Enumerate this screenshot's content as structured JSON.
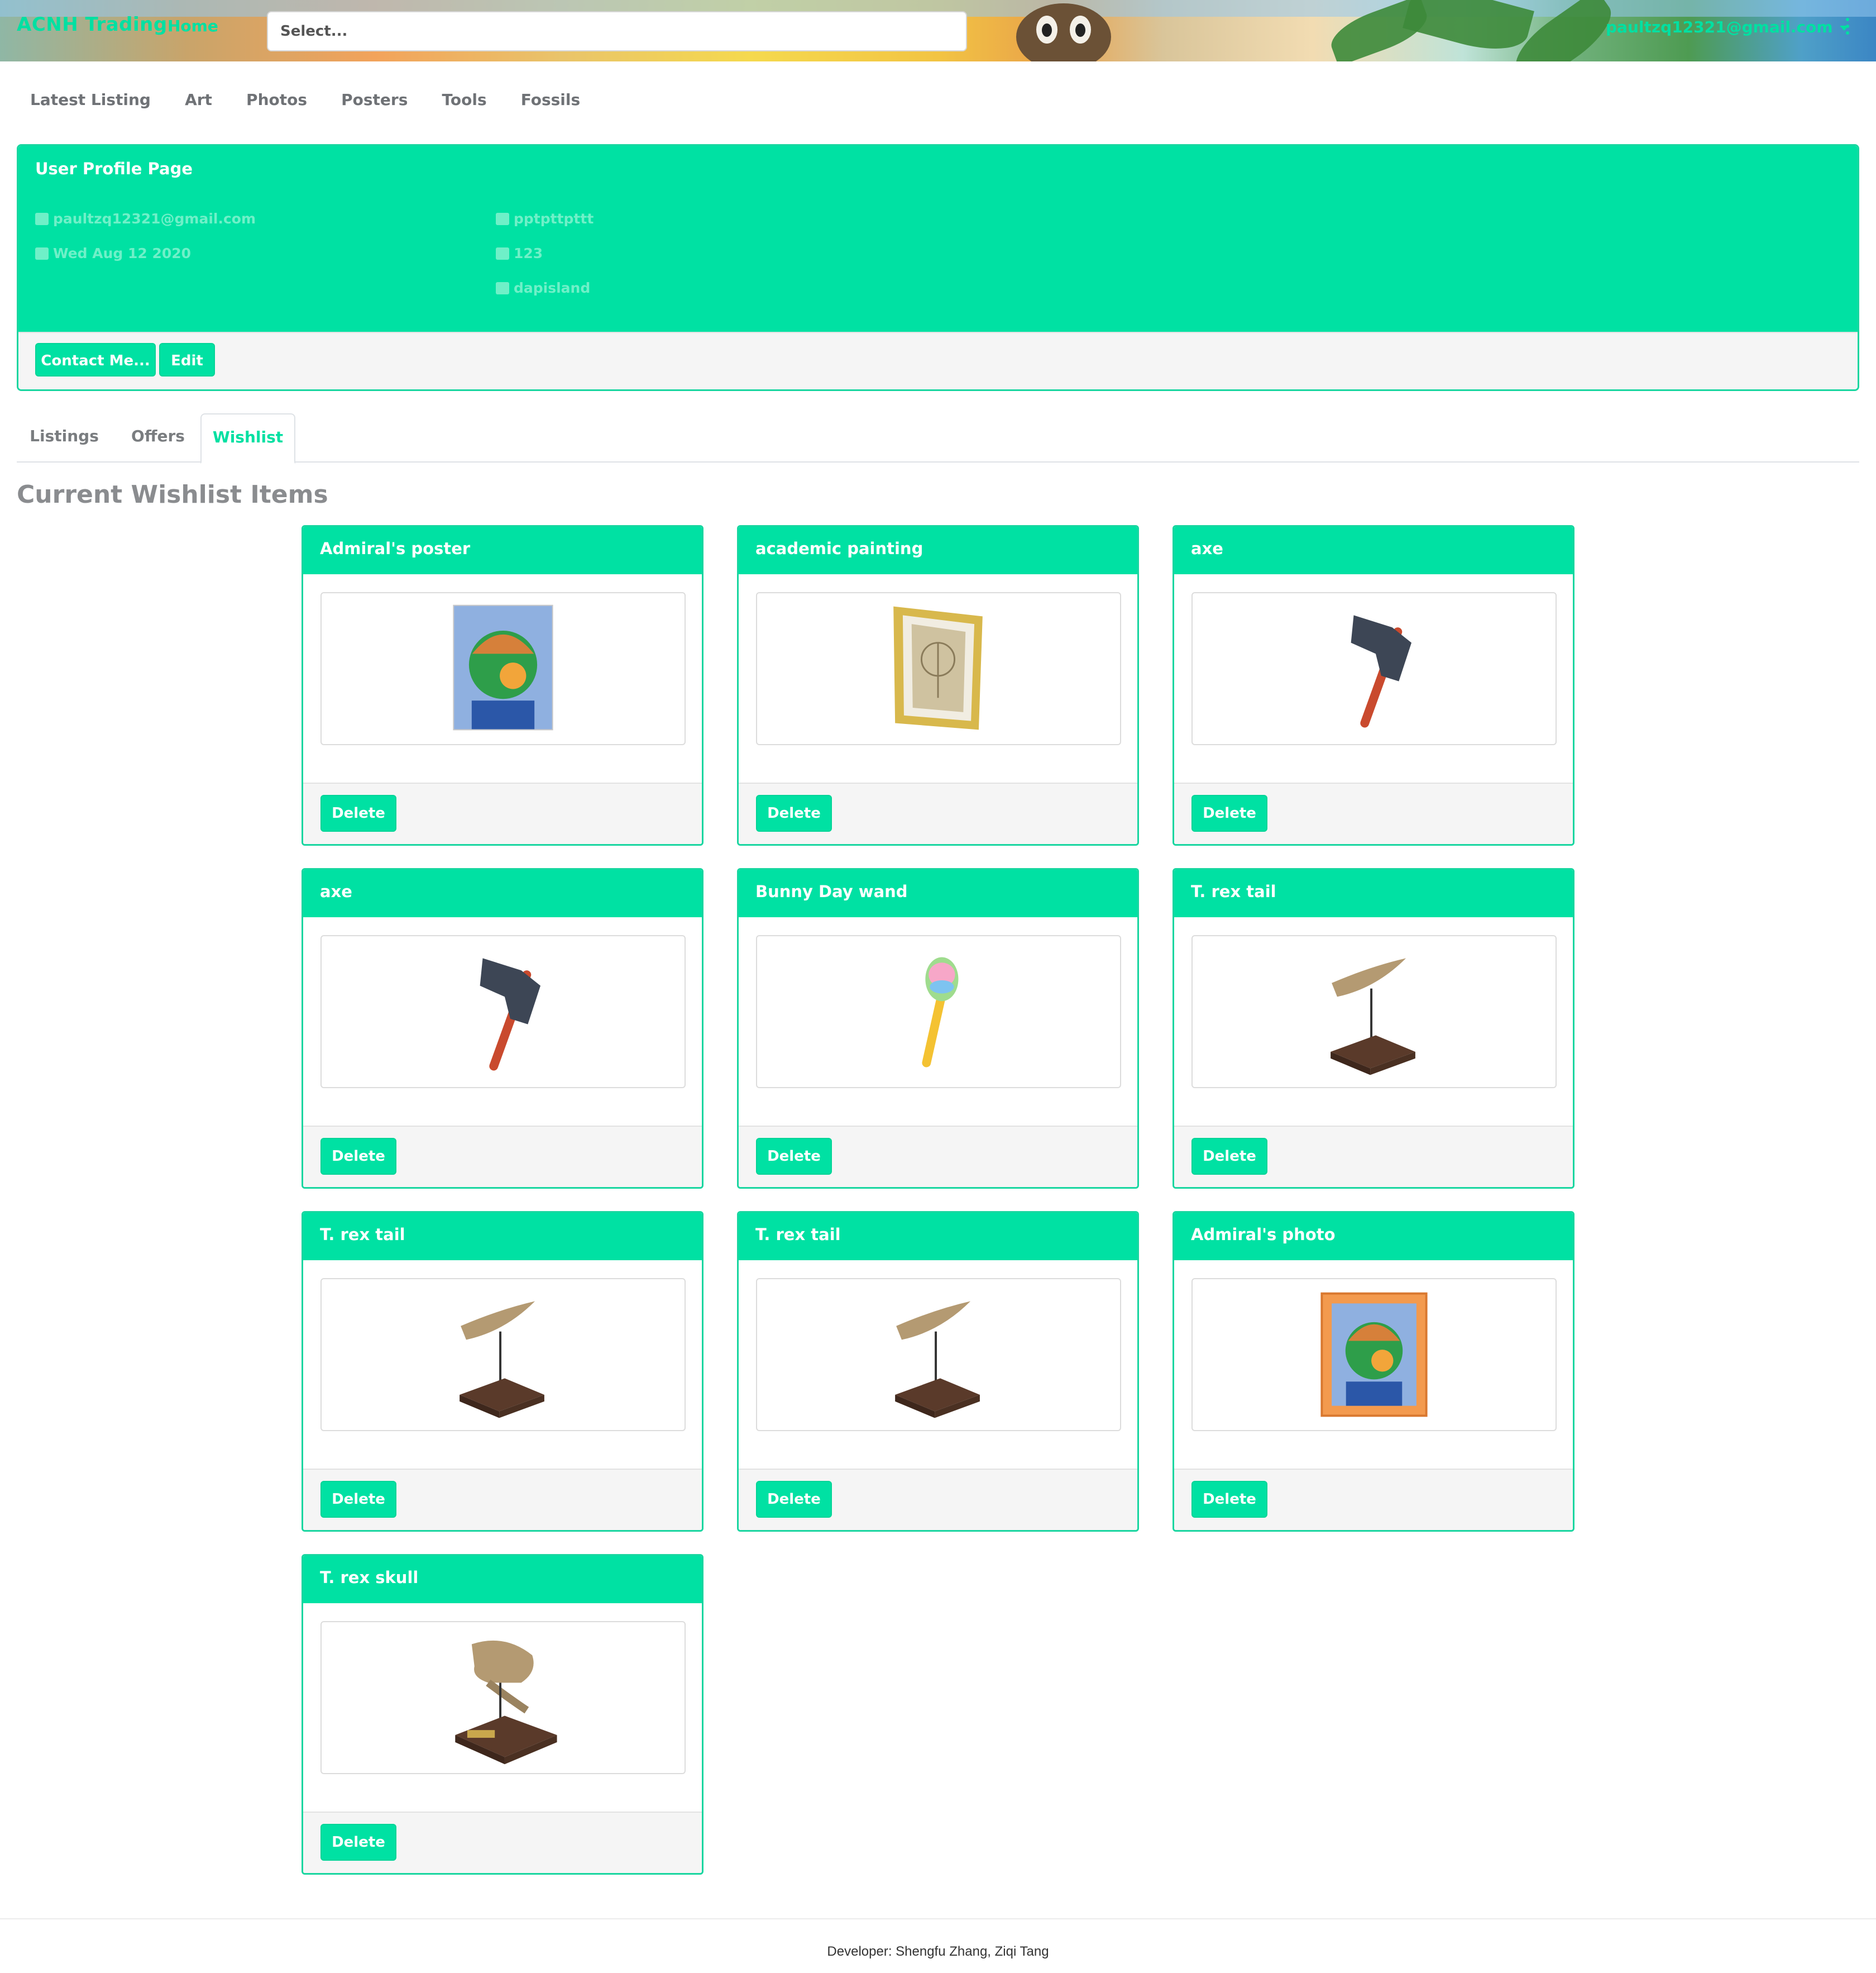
{
  "navbar": {
    "brand": "ACNH Trading",
    "home": "Home",
    "search_placeholder": "Select...",
    "user": "paultzq12321@gmail.com"
  },
  "categories": [
    "Latest Listing",
    "Art",
    "Photos",
    "Posters",
    "Tools",
    "Fossils"
  ],
  "profile": {
    "title": "User Profile Page",
    "email": "paultzq12321@gmail.com",
    "date": "Wed Aug 12 2020",
    "username": "pptpttpttt",
    "code": "123",
    "island": "dapisland",
    "contact_label": "Contact Me...",
    "edit_label": "Edit"
  },
  "tabs": [
    "Listings",
    "Offers",
    "Wishlist"
  ],
  "active_tab": "Wishlist",
  "section_title": "Current Wishlist Items",
  "delete_label": "Delete",
  "items": [
    {
      "name": "Admiral's poster",
      "icon": "admiral-poster-image"
    },
    {
      "name": "academic painting",
      "icon": "academic-painting-image"
    },
    {
      "name": "axe",
      "icon": "axe-image"
    },
    {
      "name": "axe",
      "icon": "axe-image"
    },
    {
      "name": "Bunny Day wand",
      "icon": "bunny-day-wand-image"
    },
    {
      "name": "T. rex tail",
      "icon": "t-rex-tail-image"
    },
    {
      "name": "T. rex tail",
      "icon": "t-rex-tail-image"
    },
    {
      "name": "T. rex tail",
      "icon": "t-rex-tail-image"
    },
    {
      "name": "Admiral's photo",
      "icon": "admiral-photo-image"
    },
    {
      "name": "T. rex skull",
      "icon": "t-rex-skull-image"
    }
  ],
  "footer": {
    "credit": "Developer: Shengfu Zhang, Ziqi Tang"
  },
  "colors": {
    "accent": "#00e1a3",
    "accent_text": "#00e0a2"
  }
}
